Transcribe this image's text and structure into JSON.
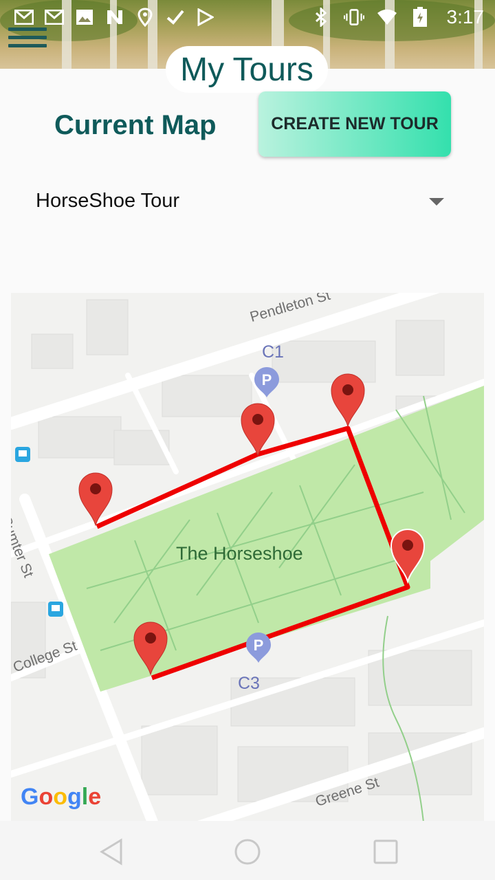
{
  "status_bar": {
    "time": "3:17",
    "left_icons": [
      "gmail-icon",
      "gmail-icon",
      "gallery-icon",
      "n-app-icon",
      "maps-icon",
      "checkmark-icon",
      "play-store-icon"
    ],
    "right_icons": [
      "bluetooth-icon",
      "vibrate-icon",
      "wifi-icon",
      "battery-icon"
    ]
  },
  "header": {
    "title": "My Tours"
  },
  "main": {
    "section_title": "Current Map",
    "create_button_label": "CREATE NEW TOUR",
    "selected_tour": "HorseShoe Tour"
  },
  "map": {
    "park_label": "The Horseshoe",
    "streets": [
      "Pendleton St",
      "Sumter St",
      "College St",
      "Greene St"
    ],
    "parking_labels": [
      "C1",
      "C3"
    ],
    "google_logo": "Google",
    "route_color": "#ee0000",
    "marker_color": "#e8453c",
    "park_color": "#c0e8a8"
  },
  "nav_bar": {
    "icons": [
      "back-icon",
      "home-icon",
      "recents-icon"
    ]
  }
}
